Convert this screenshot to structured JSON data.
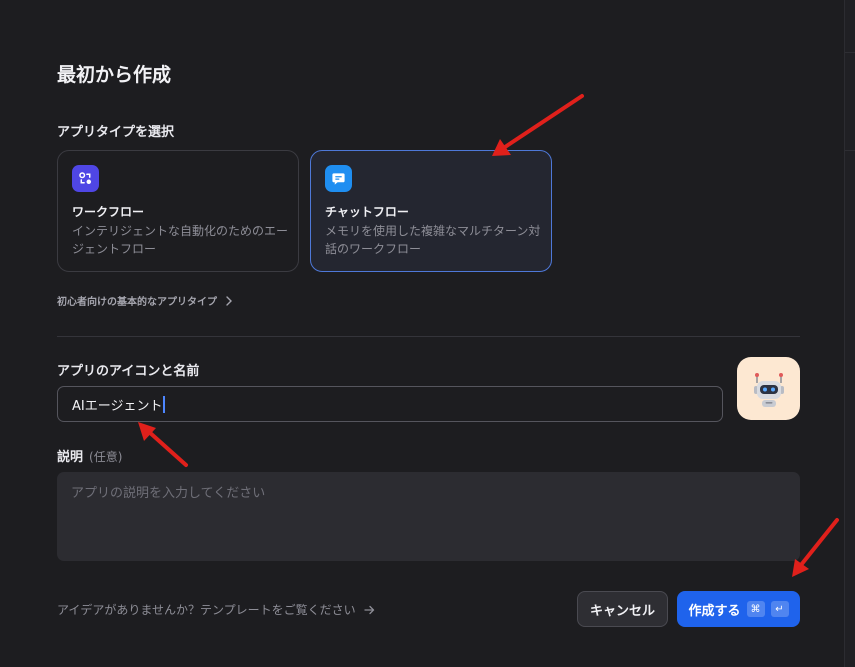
{
  "dialog": {
    "title": "最初から作成",
    "app_type_label": "アプリタイプを選択",
    "cards": [
      {
        "title": "ワークフロー",
        "desc": "インテリジェントな自動化のためのエージェントフロー",
        "selected": false,
        "icon": "workflow-icon",
        "color": "#4f46e5"
      },
      {
        "title": "チャットフロー",
        "desc": "メモリを使用した複雑なマルチターン対話のワークフロー",
        "selected": true,
        "icon": "chat-bubble-icon",
        "color": "#1f8ef1"
      }
    ],
    "basic_types_link": "初心者向けの基本的なアプリタイプ",
    "name_label": "アプリのアイコンと名前",
    "name_value": "AIエージェント",
    "description_label": "説明",
    "description_optional": "(任意)",
    "description_placeholder": "アプリの説明を入力してください",
    "idea_link": "アイデアがありませんか？テンプレートをご覧ください",
    "cancel_label": "キャンセル",
    "create_label": "作成する",
    "shortcut_keys": [
      "⌘",
      "↵"
    ]
  },
  "colors": {
    "accent": "#1f63ec",
    "selected_border": "#4e78d8",
    "annotation_arrow": "#e0201b",
    "app_icon_bg": "#fde8d2"
  }
}
